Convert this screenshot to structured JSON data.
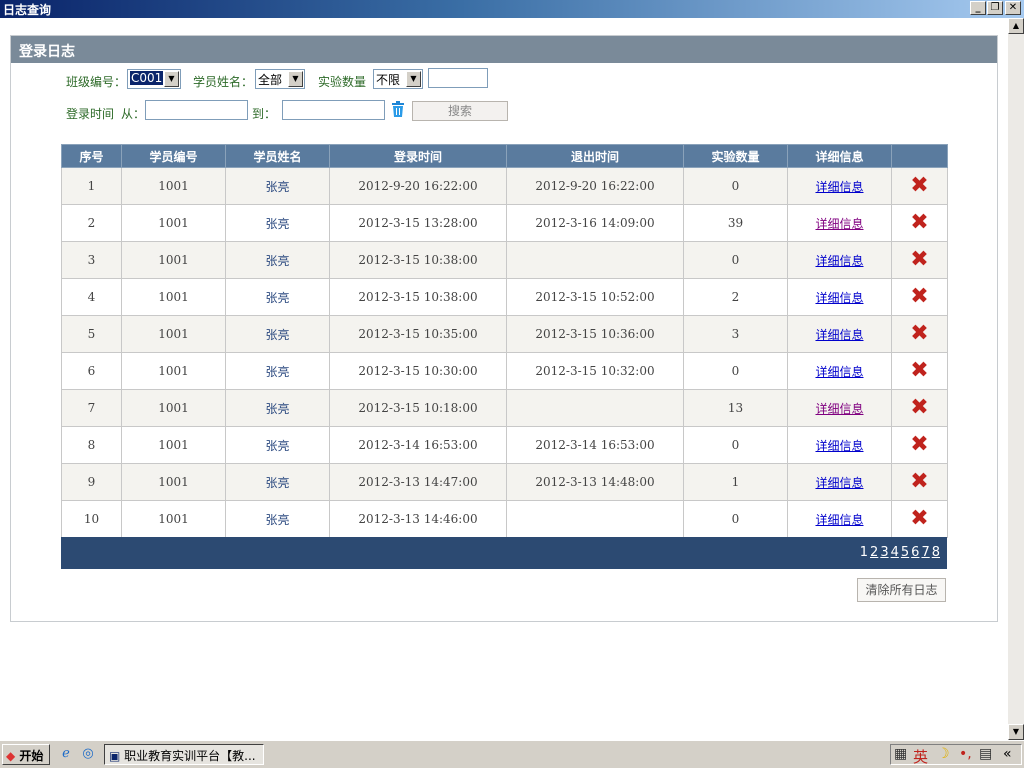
{
  "window": {
    "title": "日志查询",
    "min_glyph": "_",
    "max_glyph": "❐",
    "close_glyph": "✕"
  },
  "panel": {
    "title": "登录日志"
  },
  "filters": {
    "class_label": "班级编号：",
    "class_value": "C001",
    "student_label": "学员姓名：",
    "student_value": "全部",
    "count_label": "实验数量",
    "count_value": "不限",
    "count_input": "",
    "time_label": "登录时间",
    "from_label": "从：",
    "to_label": "到：",
    "search_label": "搜索",
    "clear_icon": "trash-icon"
  },
  "table": {
    "headers": [
      "序号",
      "学员编号",
      "学员姓名",
      "登录时间",
      "退出时间",
      "实验数量",
      "详细信息",
      ""
    ],
    "detail_text": "详细信息",
    "rows": [
      {
        "no": "1",
        "id": "1001",
        "name": "张亮",
        "login": "2012-9-20 16:22:00",
        "logout": "2012-9-20 16:22:00",
        "count": "0",
        "visited": false
      },
      {
        "no": "2",
        "id": "1001",
        "name": "张亮",
        "login": "2012-3-15 13:28:00",
        "logout": "2012-3-16 14:09:00",
        "count": "39",
        "visited": true
      },
      {
        "no": "3",
        "id": "1001",
        "name": "张亮",
        "login": "2012-3-15 10:38:00",
        "logout": "",
        "count": "0",
        "visited": false
      },
      {
        "no": "4",
        "id": "1001",
        "name": "张亮",
        "login": "2012-3-15 10:38:00",
        "logout": "2012-3-15 10:52:00",
        "count": "2",
        "visited": false
      },
      {
        "no": "5",
        "id": "1001",
        "name": "张亮",
        "login": "2012-3-15 10:35:00",
        "logout": "2012-3-15 10:36:00",
        "count": "3",
        "visited": false
      },
      {
        "no": "6",
        "id": "1001",
        "name": "张亮",
        "login": "2012-3-15 10:30:00",
        "logout": "2012-3-15 10:32:00",
        "count": "0",
        "visited": false
      },
      {
        "no": "7",
        "id": "1001",
        "name": "张亮",
        "login": "2012-3-15 10:18:00",
        "logout": "",
        "count": "13",
        "visited": true
      },
      {
        "no": "8",
        "id": "1001",
        "name": "张亮",
        "login": "2012-3-14 16:53:00",
        "logout": "2012-3-14 16:53:00",
        "count": "0",
        "visited": false
      },
      {
        "no": "9",
        "id": "1001",
        "name": "张亮",
        "login": "2012-3-13 14:47:00",
        "logout": "2012-3-13 14:48:00",
        "count": "1",
        "visited": false
      },
      {
        "no": "10",
        "id": "1001",
        "name": "张亮",
        "login": "2012-3-13 14:46:00",
        "logout": "",
        "count": "0",
        "visited": false
      }
    ]
  },
  "pager": {
    "pages": [
      "1",
      "2",
      "3",
      "4",
      "5",
      "6",
      "7",
      "8"
    ],
    "current": "1"
  },
  "clear_all_label": "清除所有日志",
  "taskbar": {
    "start_label": "开始",
    "task_label": "职业教育实训平台【教...",
    "ime_label": "英",
    "collapse_glyph": "«"
  },
  "colors": {
    "header_bar": "#7a8a99",
    "table_header": "#5a7b9e",
    "pager_bar": "#2c4a72",
    "label_green": "#2d6a28",
    "delete_red": "#c0231d"
  }
}
